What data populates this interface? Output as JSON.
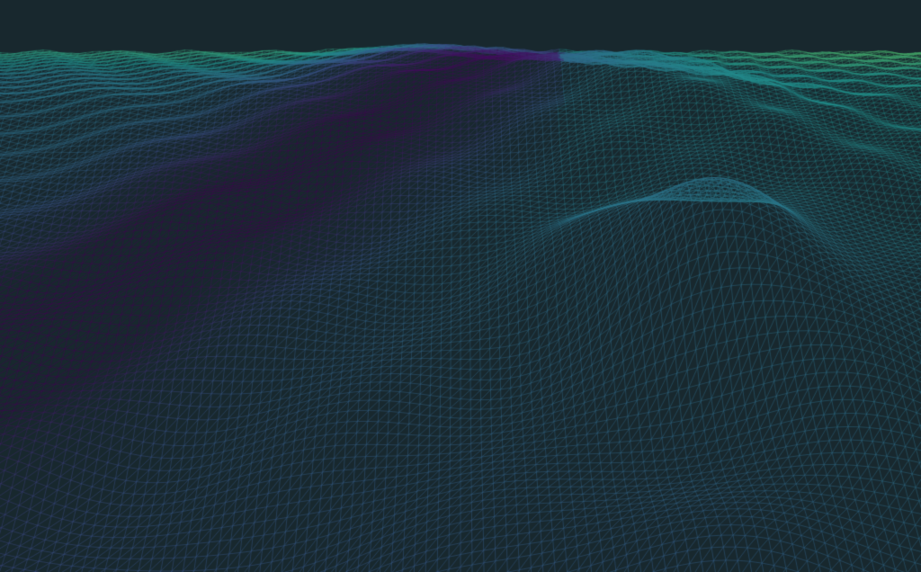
{
  "scene": {
    "kind": "terrain-wireframe",
    "background_color": "#18282e",
    "colormap": [
      "#440154",
      "#3b528b",
      "#21918c",
      "#5ec962",
      "#fde725"
    ],
    "line_color_near": "#2fbfa6"
  }
}
